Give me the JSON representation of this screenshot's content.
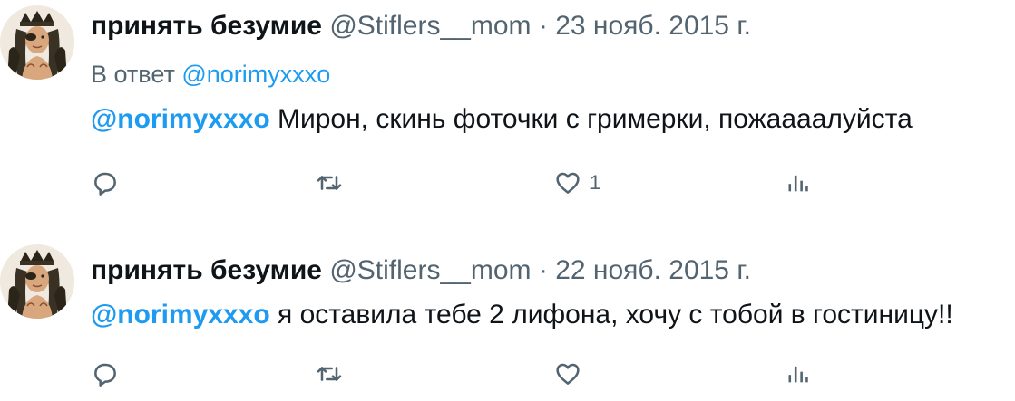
{
  "tweets": [
    {
      "display_name": "принять безумие",
      "handle": "@Stiflers__mom",
      "separator": "·",
      "date": "23 нояб. 2015 г.",
      "reply_prefix": "В ответ",
      "reply_to": "@norimyxxxo",
      "mention": "@norimyxxxo",
      "text": " Мирон, скинь фоточки с гримерки, пожаааалуйста",
      "like_count": "1",
      "icons": [
        "reply-icon",
        "retweet-icon",
        "like-icon",
        "views-icon"
      ]
    },
    {
      "display_name": "принять безумие",
      "handle": "@Stiflers__mom",
      "separator": "·",
      "date": "22 нояб. 2015 г.",
      "mention": "@norimyxxxo",
      "text": " я оставила тебе 2 лифона, хочу с тобой в гостиницу!!",
      "like_count": "",
      "icons": [
        "reply-icon",
        "retweet-icon",
        "like-icon",
        "views-icon"
      ]
    }
  ],
  "colors": {
    "link": "#1d9bf0",
    "secondary_text": "#536471",
    "primary_text": "#0f1419",
    "divider": "#eff3f4"
  }
}
